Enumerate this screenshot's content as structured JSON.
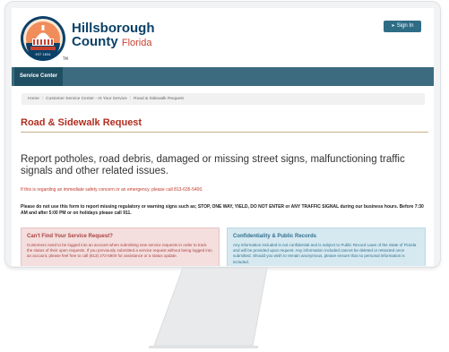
{
  "logo": {
    "seal_year": "EST 1834",
    "tm": "TM",
    "line1": "Hillsborough",
    "line2": "County",
    "state": "Florida"
  },
  "header": {
    "signin_label": "Sign In"
  },
  "nav": {
    "service_center": "Service Center"
  },
  "breadcrumb": {
    "items": [
      "Home",
      "Customer Service Center - At Your Service",
      "Road & Sidewalk Request"
    ]
  },
  "page": {
    "title": "Road & Sidewalk Request",
    "lead": "Report potholes, road debris, damaged or missing street signs, malfunctioning traffic signals and other related issues.",
    "alert": "If this is regarding an immediate safety concern or an emergency, please call 813-635-5400.",
    "warning": "Please do not use this form to report missing regulatory or warning signs such as; STOP, ONE WAY, YIELD, DO NOT ENTER or ANY TRAFFIC SIGNAL during our business hours. Before 7:30 AM and after 5:00 PM or on holidays please call 911."
  },
  "panels": {
    "left": {
      "title": "Can't Find Your Service Request?",
      "body": "Customers need to be logged into an account when submitting new service requests in order to track the status of their open requests. If you previously submitted a service request without being logged into an account, please feel free to call (813) 272-5900 for assistance or a status update."
    },
    "right": {
      "title": "Confidentiality & Public Records",
      "body": "Any information included is not confidential and is subject to Public Record Laws of the State of Florida and will be provided upon request. Any information included cannot be deleted or retracted once submitted. Should you wish to remain anonymous, please ensure that no personal information is included."
    }
  },
  "colors": {
    "brand_navy": "#0b4168",
    "brand_red": "#b02e1f",
    "nav_bar": "#3c6b80",
    "nav_active": "#1f4f63",
    "danger_panel": "#f4dede",
    "info_panel": "#d6e9f1"
  },
  "icons": {
    "signin": "sign-in-icon",
    "seal": "county-seal-logo"
  }
}
